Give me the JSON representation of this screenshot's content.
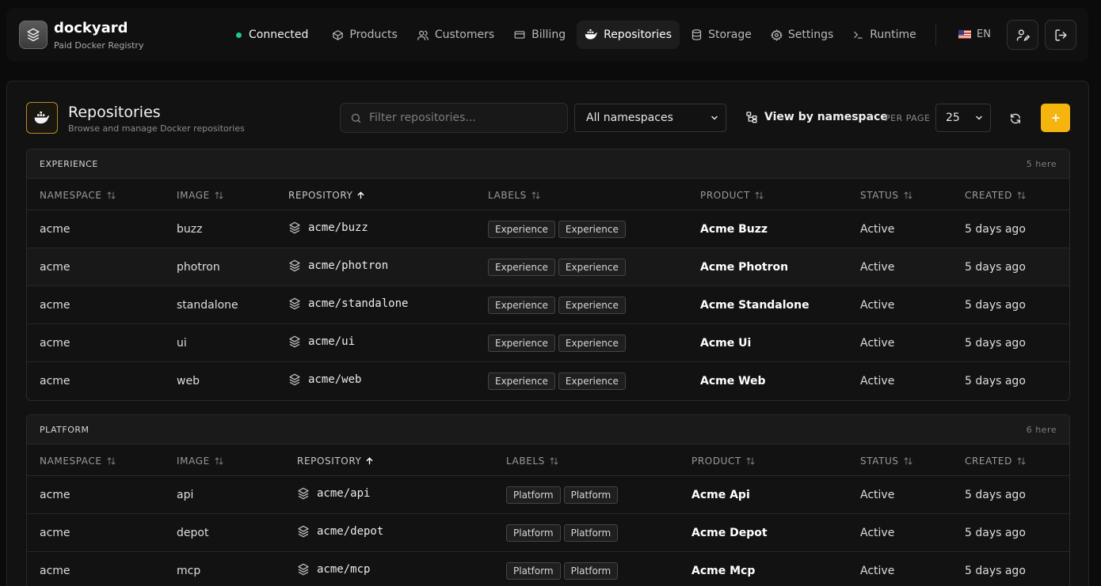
{
  "brand": {
    "name": "dockyard",
    "subtitle": "Paid Docker Registry"
  },
  "nav": {
    "status": "Connected",
    "items": [
      {
        "label": "Products",
        "icon": "box-icon"
      },
      {
        "label": "Customers",
        "icon": "users-icon"
      },
      {
        "label": "Billing",
        "icon": "credit-card-icon"
      },
      {
        "label": "Repositories",
        "icon": "docker-whale-icon",
        "active": true
      },
      {
        "label": "Storage",
        "icon": "database-icon"
      },
      {
        "label": "Settings",
        "icon": "gear-icon"
      },
      {
        "label": "Runtime",
        "icon": "terminal-icon"
      }
    ],
    "language": "EN"
  },
  "page": {
    "title": "Repositories",
    "subtitle": "Browse and manage Docker repositories",
    "search_placeholder": "Filter repositories...",
    "namespace_filter": "All namespaces",
    "view_toggle": "View by namespace",
    "per_page_label": "PER PAGE",
    "per_page_value": "25"
  },
  "columns": [
    "NAMESPACE",
    "IMAGE",
    "REPOSITORY",
    "LABELS",
    "PRODUCT",
    "STATUS",
    "CREATED"
  ],
  "sorted_column": "REPOSITORY",
  "groups": [
    {
      "name": "EXPERIENCE",
      "count": "5 here",
      "rows": [
        {
          "namespace": "acme",
          "image": "buzz",
          "repository": "acme/buzz",
          "labels": [
            "Experience",
            "Experience"
          ],
          "product": "Acme Buzz",
          "status": "Active",
          "created": "5 days ago"
        },
        {
          "namespace": "acme",
          "image": "photron",
          "repository": "acme/photron",
          "labels": [
            "Experience",
            "Experience"
          ],
          "product": "Acme Photron",
          "status": "Active",
          "created": "5 days ago"
        },
        {
          "namespace": "acme",
          "image": "standalone",
          "repository": "acme/standalone",
          "labels": [
            "Experience",
            "Experience"
          ],
          "product": "Acme Standalone",
          "status": "Active",
          "created": "5 days ago"
        },
        {
          "namespace": "acme",
          "image": "ui",
          "repository": "acme/ui",
          "labels": [
            "Experience",
            "Experience"
          ],
          "product": "Acme Ui",
          "status": "Active",
          "created": "5 days ago"
        },
        {
          "namespace": "acme",
          "image": "web",
          "repository": "acme/web",
          "labels": [
            "Experience",
            "Experience"
          ],
          "product": "Acme Web",
          "status": "Active",
          "created": "5 days ago"
        }
      ]
    },
    {
      "name": "PLATFORM",
      "count": "6 here",
      "rows": [
        {
          "namespace": "acme",
          "image": "api",
          "repository": "acme/api",
          "labels": [
            "Platform",
            "Platform"
          ],
          "product": "Acme Api",
          "status": "Active",
          "created": "5 days ago"
        },
        {
          "namespace": "acme",
          "image": "depot",
          "repository": "acme/depot",
          "labels": [
            "Platform",
            "Platform"
          ],
          "product": "Acme Depot",
          "status": "Active",
          "created": "5 days ago"
        },
        {
          "namespace": "acme",
          "image": "mcp",
          "repository": "acme/mcp",
          "labels": [
            "Platform",
            "Platform"
          ],
          "product": "Acme Mcp",
          "status": "Active",
          "created": "5 days ago"
        }
      ]
    }
  ],
  "colors": {
    "accent": "#f5b40e",
    "status_dot": "#22c58b",
    "background": "#0b0b0b"
  }
}
